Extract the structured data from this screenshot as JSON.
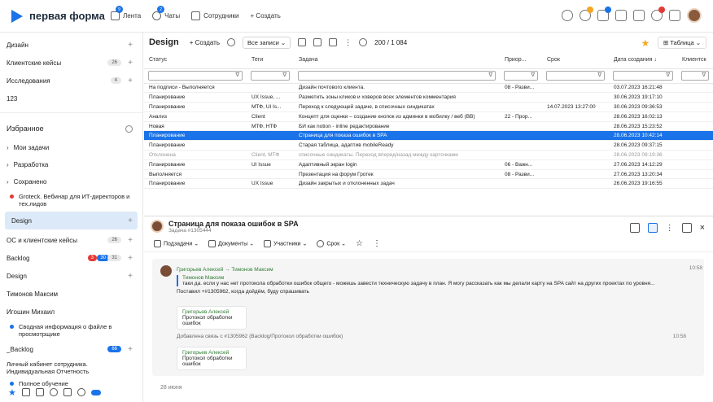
{
  "app": {
    "logo_text": "первая форма",
    "brand_color": "#1a73e8"
  },
  "topnav": [
    {
      "label": "Лента",
      "badge": "9",
      "icon": "feed-icon"
    },
    {
      "label": "Чаты",
      "badge": "2",
      "icon": "chat-icon"
    },
    {
      "label": "Сотрудники",
      "icon": "people-icon"
    },
    {
      "label": "+ Создать",
      "icon": ""
    }
  ],
  "sidebar": {
    "top_items": [
      {
        "label": "Дизайн",
        "count": ""
      },
      {
        "label": "Клиентские кейсы",
        "count": "26"
      },
      {
        "label": "Исследования",
        "count": "4"
      },
      {
        "label": "123",
        "count": ""
      }
    ],
    "favorites_title": "Избранное",
    "groups": [
      "Мои задачи",
      "Разработка",
      "Сохранено"
    ],
    "saved_item": "Groteck. Вебинар для ИТ-директоров и тех.лидов",
    "selected": "Design",
    "items2": [
      {
        "label": "ОС и клиентские кейсы",
        "count": "26"
      },
      {
        "label": "Backlog",
        "count": "31",
        "red": "3",
        "blue": "30"
      },
      {
        "label": "Design",
        "count": ""
      },
      {
        "label": "Тимонов Максим",
        "count": ""
      },
      {
        "label": "Игошин Михаил",
        "count": ""
      }
    ],
    "summary": "Сводная информация о файле в просмотрщике",
    "backlog2": {
      "label": "_Backlog",
      "count": "66"
    },
    "cabinet": "Личный кабинет сотрудника. Индивидуальная Отчетность",
    "training": "Полное обучение"
  },
  "toolbar": {
    "title": "Design",
    "create": "+ Создать",
    "all_records": "Все записи",
    "counter": "200 / 1 084",
    "view": "Таблица"
  },
  "table": {
    "headers": [
      "Статус",
      "Теги",
      "Задача",
      "Приор...",
      "Срок",
      "Дата создания ↓",
      "Клиентск"
    ],
    "rows": [
      [
        "На подписи - Выполняется",
        "",
        "Дизайн почтового клиента.",
        "08 - Разви...",
        "",
        "03.07.2023 16:21:48"
      ],
      [
        "Планирование",
        "UX Issue, ...",
        "Разметить зоны кликов и ховеров всех элементов комментария",
        "",
        "",
        "30.06.2023 19:17:10"
      ],
      [
        "Планирование",
        "МТФ, UI Is...",
        "Переход к следующей задаче, в списочных синдикатах",
        "",
        "14.07.2023 13:27:00",
        "30.06.2023 09:36:53"
      ],
      [
        "Анализ",
        "Client",
        "Концепт для оценки – создание кнопок из админки в мобилку / веб (ВВ)",
        "22 - Пpоp...",
        "",
        "28.06.2023 16:02:13"
      ],
      [
        "Новая",
        "МТФ, НТФ",
        "БИ как notion - inline редактирование",
        "",
        "",
        "28.06.2023 15:23:52"
      ],
      [
        "Планирование",
        "",
        "Страница для показа ошибок в SPA",
        "",
        "",
        "28.06.2023 10:42:14"
      ],
      [
        "Планирование",
        "",
        "Старая таблица, адаптив mobileReady",
        "",
        "",
        "28.06.2023 09:37:15"
      ],
      [
        "Отклонена",
        "Client, МТФ",
        "списочные синдикаты. Переход вперед/назад между карточками",
        "",
        "",
        "28.06.2023 09:19:36"
      ],
      [
        "Планирование",
        "UI Issue",
        "Адаптивный экран login",
        "06 - Важн...",
        "",
        "27.06.2023 14:12:29"
      ],
      [
        "Выполняется",
        "",
        "Презентация на форум Гротек",
        "08 - Разви...",
        "",
        "27.06.2023 13:20:34"
      ],
      [
        "Планирование",
        "UX Issue",
        "Дизайн закрытых и отклоненных задач",
        "",
        "",
        "26.06.2023 19:16:55"
      ]
    ],
    "selected_row": 5,
    "muted_row": 7
  },
  "detail": {
    "title": "Страница для показа ошибок в SPA",
    "subtitle": "Задача #1305444",
    "tabs": [
      "Подзадачи",
      "Документы",
      "Участники",
      "Срок"
    ],
    "msg1": {
      "from": "Григорьев Алексей",
      "to": "Тимонов Максим",
      "quote_author": "Тимонов Максим",
      "quote": "таки да. если у нас нет протокола обработки ошибок общего - можешь завести техническую задачу в план. Я могу рассказать как мы делали карту на SPA сайт на других проектах по уровня...",
      "text": "Поставил +#1305962, когда дойдём, буду спрашивать",
      "time": "10:58",
      "card_author": "Григорьев Алексей",
      "card_text": "Протокол обработки ошибок"
    },
    "msg2": {
      "text": "Добавлена связь с #1305962 (Backlog/Протокол обработки ошибок)",
      "time": "10:58",
      "card_author": "Григорьев Алексей",
      "card_text": "Протокол обработки ошибок"
    },
    "date": "28 июня"
  }
}
